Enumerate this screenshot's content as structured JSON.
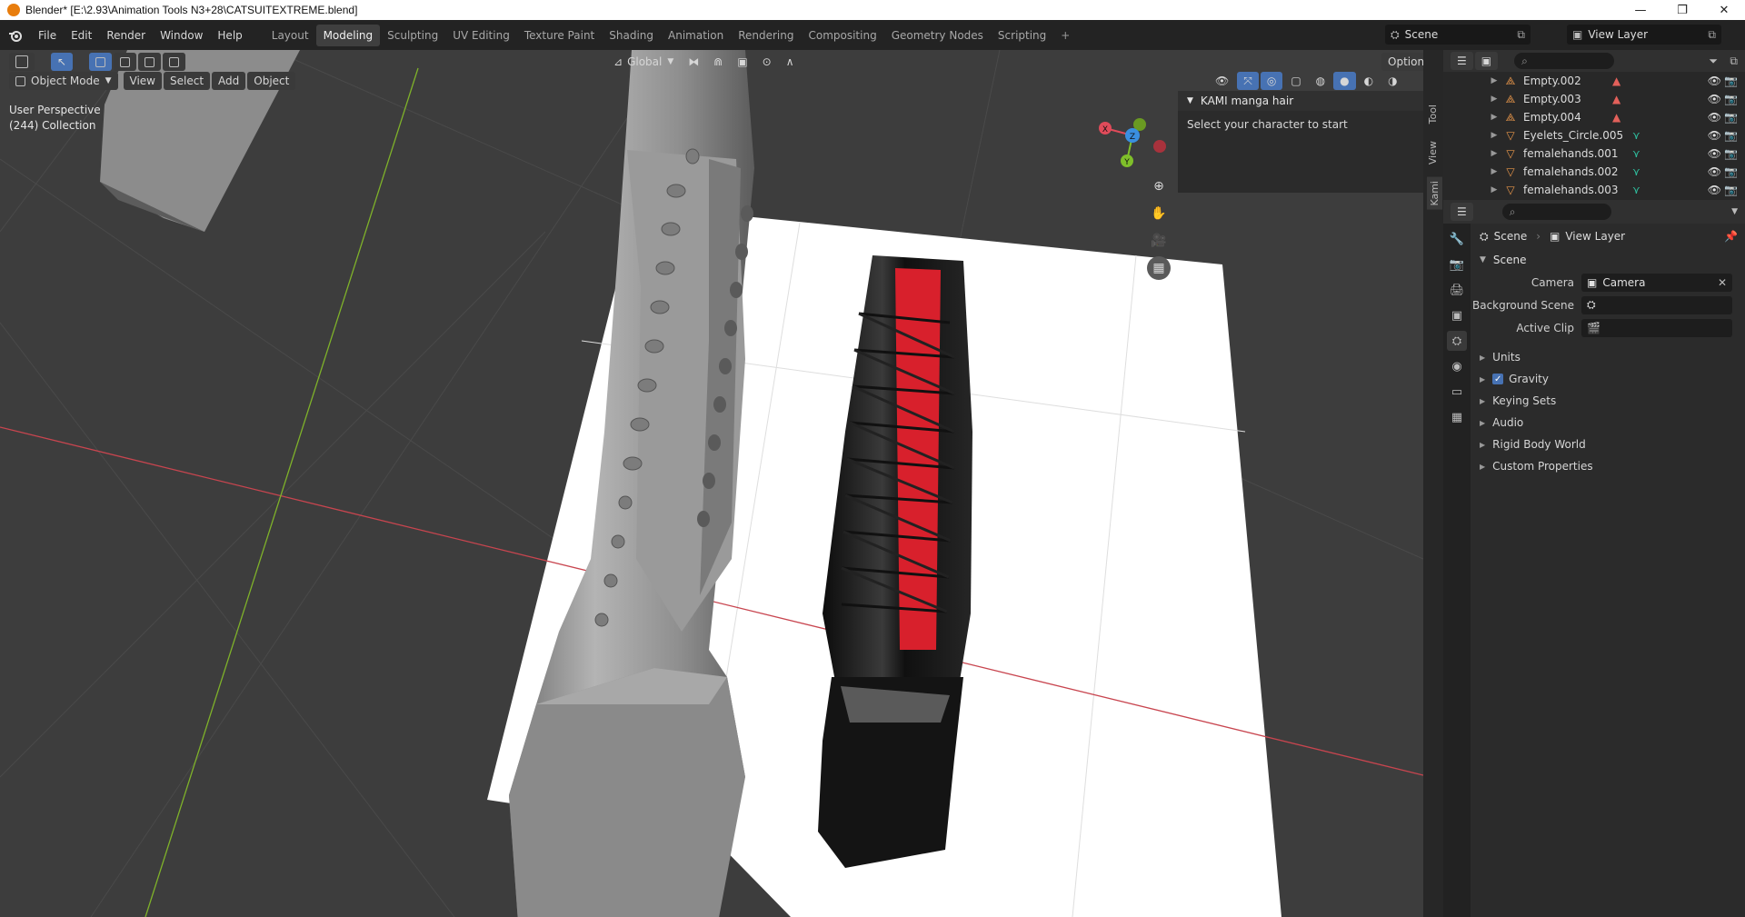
{
  "window": {
    "title": "Blender* [E:\\2.93\\Animation Tools N3+28\\CATSUITEXTREME.blend]",
    "minimize": "—",
    "maximize": "❐",
    "close": "✕"
  },
  "menu": [
    "File",
    "Edit",
    "Render",
    "Window",
    "Help"
  ],
  "workspaces": [
    "Layout",
    "Modeling",
    "Sculpting",
    "UV Editing",
    "Texture Paint",
    "Shading",
    "Animation",
    "Rendering",
    "Compositing",
    "Geometry Nodes",
    "Scripting"
  ],
  "active_workspace": "Modeling",
  "scene_field": "Scene",
  "view_layer_field": "View Layer",
  "viewport": {
    "transform_orientation": "Global",
    "options_label": "Options",
    "mode": "Object Mode",
    "header_menus": [
      "View",
      "Select",
      "Add",
      "Object"
    ],
    "info_line1": "User Perspective",
    "info_line2": "(244) Collection",
    "gizmo_axes": {
      "x": "X",
      "y": "Y",
      "z": "Z"
    }
  },
  "npanel": {
    "title": "KAMI manga hair",
    "body": "Select your character to start",
    "tabs": [
      "Tool",
      "View",
      "Kami"
    ]
  },
  "outliner": {
    "rows": [
      {
        "name": "Empty.002",
        "type": "empty",
        "sub": "image"
      },
      {
        "name": "Empty.003",
        "type": "empty",
        "sub": "image"
      },
      {
        "name": "Empty.004",
        "type": "empty",
        "sub": "image"
      },
      {
        "name": "Eyelets_Circle.005",
        "type": "mesh",
        "sub": "mesh"
      },
      {
        "name": "femalehands.001",
        "type": "mesh",
        "sub": "mesh"
      },
      {
        "name": "femalehands.002",
        "type": "mesh",
        "sub": "mesh"
      },
      {
        "name": "femalehands.003",
        "type": "mesh",
        "sub": "mesh"
      }
    ]
  },
  "properties": {
    "breadcrumb_scene": "Scene",
    "breadcrumb_view_layer": "View Layer",
    "panel_title": "Scene",
    "camera_label": "Camera",
    "camera_value": "Camera",
    "background_scene_label": "Background Scene",
    "active_clip_label": "Active Clip",
    "subpanels": [
      "Units",
      "Gravity",
      "Keying Sets",
      "Audio",
      "Rigid Body World",
      "Custom Properties"
    ],
    "gravity_checked": true
  },
  "colors": {
    "accent": "#4772b3",
    "active_tab_bg": "#3f3f3f",
    "viewport_bg": "#3d3d3d",
    "axis_x": "#e04b5a",
    "axis_y": "#7fbf2a",
    "axis_z": "#3a8fe0"
  }
}
